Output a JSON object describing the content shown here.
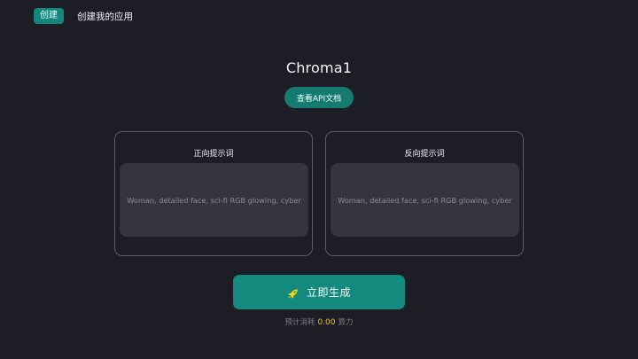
{
  "header": {
    "tag_label": "创建",
    "title": "创建我的应用"
  },
  "app": {
    "name": "Chroma1",
    "api_docs_label": "查看API文档"
  },
  "prompts": {
    "positive": {
      "label": "正向提示词",
      "placeholder": "Woman, detailed face, sci-fi RGB glowing, cyber"
    },
    "negative": {
      "label": "反向提示词",
      "placeholder": "Woman, detailed face, sci-fi RGB glowing, cyber"
    }
  },
  "generate": {
    "icon": "rocket-icon",
    "label": "立即生成"
  },
  "cost": {
    "prefix": "预计消耗",
    "amount": "0.00",
    "unit": "算力"
  },
  "colors": {
    "background": "#1c1d25",
    "accent": "#14897d",
    "input_bg": "#353540",
    "card_border": "#5b5d68",
    "cost_highlight": "#f1c40f",
    "rocket": "#f5d90a"
  }
}
